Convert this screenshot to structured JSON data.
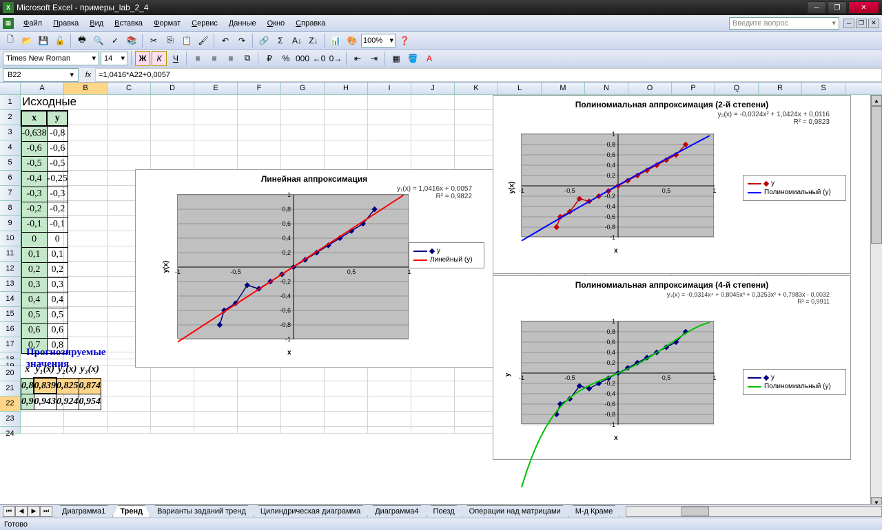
{
  "window": {
    "title": "Microsoft Excel - примеры_lab_2_4"
  },
  "menu": {
    "items": [
      "Файл",
      "Правка",
      "Вид",
      "Вставка",
      "Формат",
      "Сервис",
      "Данные",
      "Окно",
      "Справка"
    ],
    "question_placeholder": "Введите вопрос"
  },
  "toolbar2": {
    "font": "Times New Roman",
    "size": "14",
    "zoom": "100%"
  },
  "formulabar": {
    "cell": "B22",
    "formula": "=1,0416*A22+0,0057"
  },
  "columns": [
    "A",
    "B",
    "C",
    "D",
    "E",
    "F",
    "G",
    "H",
    "I",
    "J",
    "K",
    "L",
    "M",
    "N",
    "O",
    "P",
    "Q",
    "R",
    "S"
  ],
  "source": {
    "title": "Исходные данные",
    "headers": [
      "x",
      "y"
    ],
    "rows": [
      [
        "-0,638",
        "-0,8"
      ],
      [
        "-0,6",
        "-0,6"
      ],
      [
        "-0,5",
        "-0,5"
      ],
      [
        "-0,4",
        "-0,25"
      ],
      [
        "-0,3",
        "-0,3"
      ],
      [
        "-0,2",
        "-0,2"
      ],
      [
        "-0,1",
        "-0,1"
      ],
      [
        "0",
        "0"
      ],
      [
        "0,1",
        "0,1"
      ],
      [
        "0,2",
        "0,2"
      ],
      [
        "0,3",
        "0,3"
      ],
      [
        "0,4",
        "0,4"
      ],
      [
        "0,5",
        "0,5"
      ],
      [
        "0,6",
        "0,6"
      ],
      [
        "0,7",
        "0,8"
      ]
    ]
  },
  "forecast": {
    "title": "Прогнозируемые значения",
    "headers": [
      "x",
      "y₁(x)",
      "y₂(x)",
      "y₃(x)"
    ],
    "rows": [
      [
        "0,8",
        "0,839",
        "0,825",
        "0,874"
      ],
      [
        "0,9",
        "0,943",
        "0,924",
        "0,954"
      ]
    ]
  },
  "chart_data": [
    {
      "type": "scatter",
      "title": "Линейная аппроксимация",
      "equation": "y₁(x) = 1,0416x + 0,0057",
      "r2": "R² = 0,9822",
      "xlabel": "x",
      "ylabel": "y(x)",
      "xlim": [
        -1,
        1
      ],
      "ylim": [
        -1,
        1
      ],
      "x": [
        -0.638,
        -0.6,
        -0.5,
        -0.4,
        -0.3,
        -0.2,
        -0.1,
        0,
        0.1,
        0.2,
        0.3,
        0.4,
        0.5,
        0.6,
        0.7
      ],
      "y": [
        -0.8,
        -0.6,
        -0.5,
        -0.25,
        -0.3,
        -0.2,
        -0.1,
        0,
        0.1,
        0.2,
        0.3,
        0.4,
        0.5,
        0.6,
        0.8
      ],
      "series": [
        {
          "name": "y",
          "color": "#000080"
        },
        {
          "name": "Линейный (y)",
          "color": "#ff0000"
        }
      ]
    },
    {
      "type": "scatter",
      "title": "Полиномиальная аппроксимация (2-й степени)",
      "equation": "y₂(x) = -0,0324x² + 1,0424x + 0,0116",
      "r2": "R² = 0,9823",
      "xlabel": "x",
      "ylabel": "y(x)",
      "xlim": [
        -1,
        1
      ],
      "ylim": [
        -1,
        1
      ],
      "x": [
        -0.638,
        -0.6,
        -0.5,
        -0.4,
        -0.3,
        -0.2,
        -0.1,
        0,
        0.1,
        0.2,
        0.3,
        0.4,
        0.5,
        0.6,
        0.7
      ],
      "y": [
        -0.8,
        -0.6,
        -0.5,
        -0.25,
        -0.3,
        -0.2,
        -0.1,
        0,
        0.1,
        0.2,
        0.3,
        0.4,
        0.5,
        0.6,
        0.8
      ],
      "series": [
        {
          "name": "y",
          "color": "#c00000"
        },
        {
          "name": "Полиномиальный (y)",
          "color": "#0000ff"
        }
      ]
    },
    {
      "type": "scatter",
      "title": "Полиномиальная аппроксимация  (4-й степени)",
      "equation": "y₃(x) = -0,9314x⁴ + 0,8045x³ + 0,3253x² + 0,7983x - 0,0032",
      "r2": "R² = 0,9911",
      "xlabel": "x",
      "ylabel": "y",
      "xlim": [
        -1,
        1
      ],
      "ylim": [
        -1,
        1
      ],
      "x": [
        -0.638,
        -0.6,
        -0.5,
        -0.4,
        -0.3,
        -0.2,
        -0.1,
        0,
        0.1,
        0.2,
        0.3,
        0.4,
        0.5,
        0.6,
        0.7
      ],
      "y": [
        -0.8,
        -0.6,
        -0.5,
        -0.25,
        -0.3,
        -0.2,
        -0.1,
        0,
        0.1,
        0.2,
        0.3,
        0.4,
        0.5,
        0.6,
        0.8
      ],
      "series": [
        {
          "name": "y",
          "color": "#000080"
        },
        {
          "name": "Полиномиальный (y)",
          "color": "#00c000"
        }
      ]
    }
  ],
  "tabs": {
    "items": [
      "Диаграмма1",
      "Тренд",
      "Варианты заданий тренд",
      "Цилиндрическая диаграмма",
      "Диаграмма4",
      "Поезд",
      "Операции над матрицами",
      "М-д Краме"
    ],
    "active": 1
  },
  "status": {
    "ready": "Готово"
  }
}
